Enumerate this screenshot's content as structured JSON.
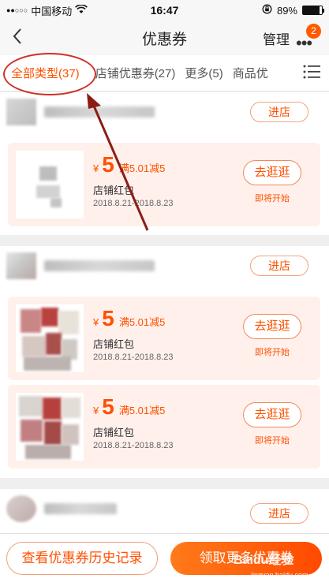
{
  "status_bar": {
    "signal_dots": "●●○○○",
    "carrier": "中国移动",
    "wifi_icon": "wifi-icon",
    "time": "16:47",
    "battery_percent": "89%",
    "battery_level": 0.89
  },
  "nav": {
    "title": "优惠券",
    "manage_label": "管理",
    "more_dots": "•••",
    "badge_count": "2"
  },
  "tabs": [
    {
      "label": "全部类型(37)",
      "active": true
    },
    {
      "label": "店铺优惠券(27)",
      "active": false
    },
    {
      "label": "更多(5)",
      "active": false
    },
    {
      "label": "商品优",
      "active": false
    }
  ],
  "stores": [
    {
      "enter_label": "进店",
      "coupons": [
        {
          "currency": "¥",
          "amount": "5",
          "condition": "满5.01减5",
          "type": "店铺红包",
          "date": "2018.8.21-2018.8.23",
          "action": "去逛逛",
          "action_sub": "即将开始"
        }
      ]
    },
    {
      "enter_label": "进店",
      "coupons": [
        {
          "currency": "¥",
          "amount": "5",
          "condition": "满5.01减5",
          "type": "店铺红包",
          "date": "2018.8.21-2018.8.23",
          "action": "去逛逛",
          "action_sub": "即将开始"
        },
        {
          "currency": "¥",
          "amount": "5",
          "condition": "满5.01减5",
          "type": "店铺红包",
          "date": "2018.8.21-2018.8.23",
          "action": "去逛逛",
          "action_sub": "即将开始"
        }
      ]
    },
    {
      "enter_label": "进店",
      "coupons": []
    }
  ],
  "bottom": {
    "history_label": "查看优惠券历史记录",
    "more_label": "领取更多优惠券"
  },
  "watermark": {
    "text": "Baidu经验",
    "url": "jingyan.baidu.com"
  },
  "colors": {
    "accent": "#ff5000",
    "annotation": "#d0312a",
    "coupon_bg": "#fff0eb"
  }
}
